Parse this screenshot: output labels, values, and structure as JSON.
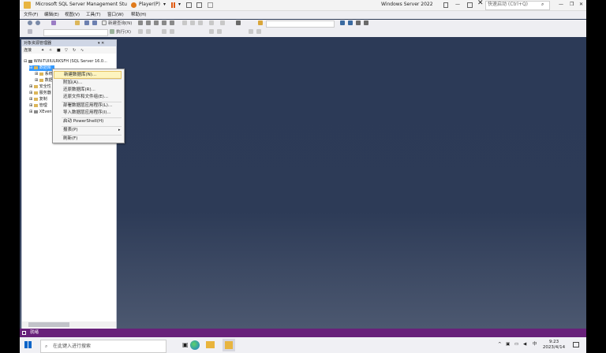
{
  "title": {
    "app": "Microsoft SQL Server Management Stu",
    "player": "Player(P)",
    "windows": "Windows Server 2022",
    "quicklaunch": "快速启动 (Ctrl+Q)"
  },
  "menu": [
    "文件(F)",
    "编辑(E)",
    "视图(V)",
    "工具(T)",
    "窗口(W)",
    "帮助(H)"
  ],
  "toolbar": {
    "new_query": "新建查询(N)",
    "execute": "执行(X)"
  },
  "object_explorer": {
    "title": "对象资源管理器",
    "connect": "连接",
    "pin": "▾ ✕",
    "server": "WIN-TUIIULRKSFH (SQL Server 16.0...",
    "nodes": [
      "数据库",
      "系统",
      "数据",
      "安全性",
      "服务器",
      "复制",
      "管理",
      "XEven"
    ]
  },
  "context_menu": {
    "items": [
      "新建数据库(N)...",
      "附加(A)...",
      "还原数据库(R)...",
      "还原文件和文件组(E)...",
      "部署数据层应用程序(L)...",
      "导入数据层应用程序(I)...",
      "启动 PowerShell(H)",
      "报表(P)",
      "刷新(F)"
    ]
  },
  "status": "就绪",
  "taskbar": {
    "search_placeholder": "在此键入进行搜索",
    "lang": "中",
    "time": "9:23",
    "date": "2023/4/14"
  },
  "colors": {
    "accent": "#68217a",
    "workspace": "#2c3a55"
  }
}
